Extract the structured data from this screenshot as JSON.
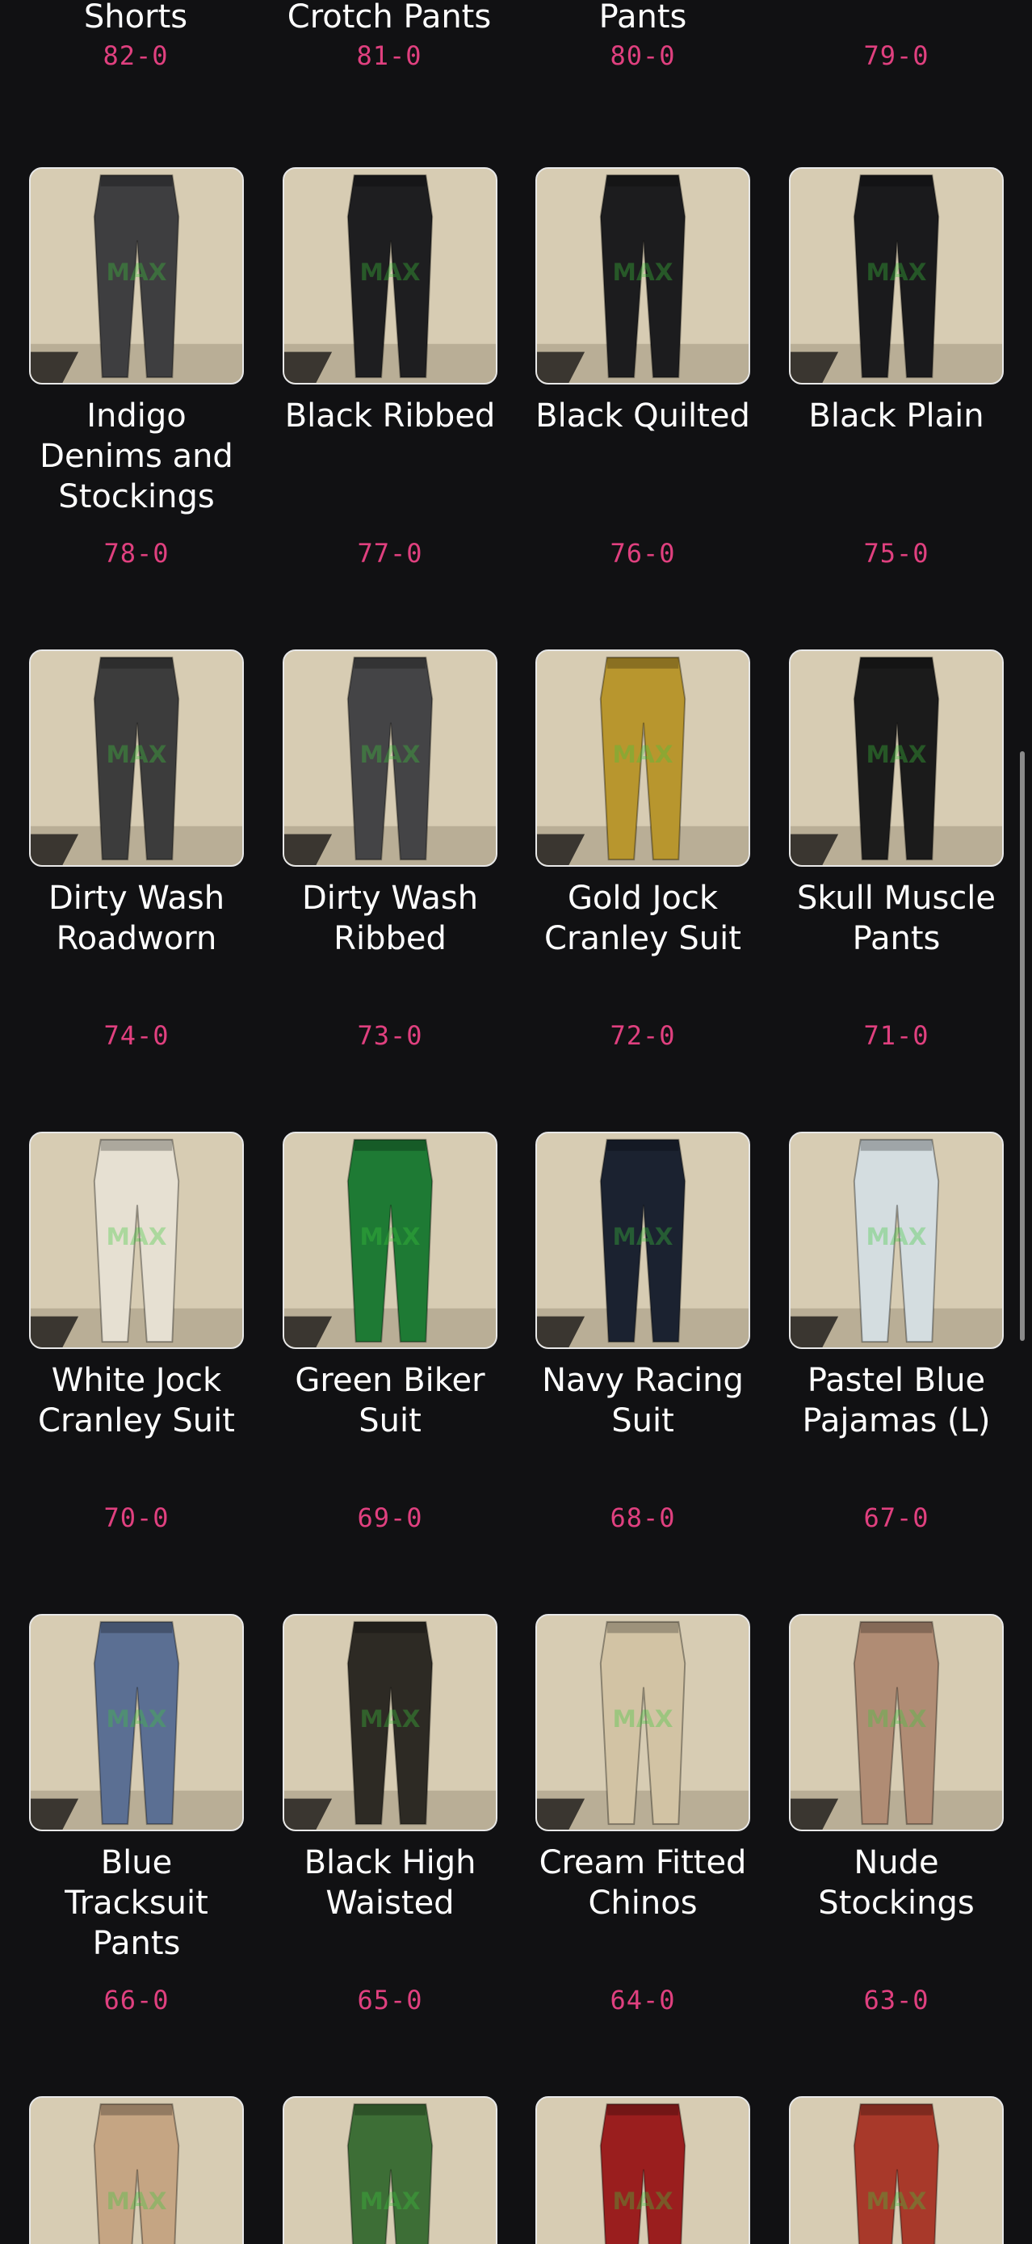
{
  "top_row": [
    {
      "name": "Shorts",
      "code": "82-0"
    },
    {
      "name": "Crotch Pants",
      "code": "81-0"
    },
    {
      "name": "Pants",
      "code": "80-0"
    },
    {
      "name": "",
      "code": "79-0"
    }
  ],
  "rows": [
    [
      {
        "name": "Indigo Denims and Stockings",
        "code": "78-0",
        "color": "#3e3e40"
      },
      {
        "name": "Black Ribbed",
        "code": "77-0",
        "color": "#1e1e20"
      },
      {
        "name": "Black Quilted",
        "code": "76-0",
        "color": "#1c1c1e"
      },
      {
        "name": "Black Plain",
        "code": "75-0",
        "color": "#1a1a1c"
      }
    ],
    [
      {
        "name": "Dirty Wash Roadworn",
        "code": "74-0",
        "color": "#3c3c3c"
      },
      {
        "name": "Dirty Wash Ribbed",
        "code": "73-0",
        "color": "#444446"
      },
      {
        "name": "Gold Jock Cranley Suit",
        "code": "72-0",
        "color": "#b8962e"
      },
      {
        "name": "Skull Muscle Pants",
        "code": "71-0",
        "color": "#1b1b1b"
      }
    ],
    [
      {
        "name": "White Jock Cranley Suit",
        "code": "70-0",
        "color": "#e6e0d2"
      },
      {
        "name": "Green Biker Suit",
        "code": "69-0",
        "color": "#1e7a34"
      },
      {
        "name": "Navy Racing Suit",
        "code": "68-0",
        "color": "#1b2230"
      },
      {
        "name": "Pastel Blue Pajamas (L)",
        "code": "67-0",
        "color": "#d4dde0"
      }
    ],
    [
      {
        "name": "Blue Tracksuit Pants",
        "code": "66-0",
        "color": "#5b6f93"
      },
      {
        "name": "Black High Waisted",
        "code": "65-0",
        "color": "#2d2a24"
      },
      {
        "name": "Cream Fitted Chinos",
        "code": "64-0",
        "color": "#d2c3a4"
      },
      {
        "name": "Nude Stockings",
        "code": "63-0",
        "color": "#b08c74"
      }
    ],
    [
      {
        "name": "",
        "code": "",
        "color": "#c5a583"
      },
      {
        "name": "",
        "code": "",
        "color": "#3d6e36"
      },
      {
        "name": "",
        "code": "",
        "color": "#9a1e1e"
      },
      {
        "name": "",
        "code": "",
        "color": "#a8392a"
      }
    ]
  ]
}
